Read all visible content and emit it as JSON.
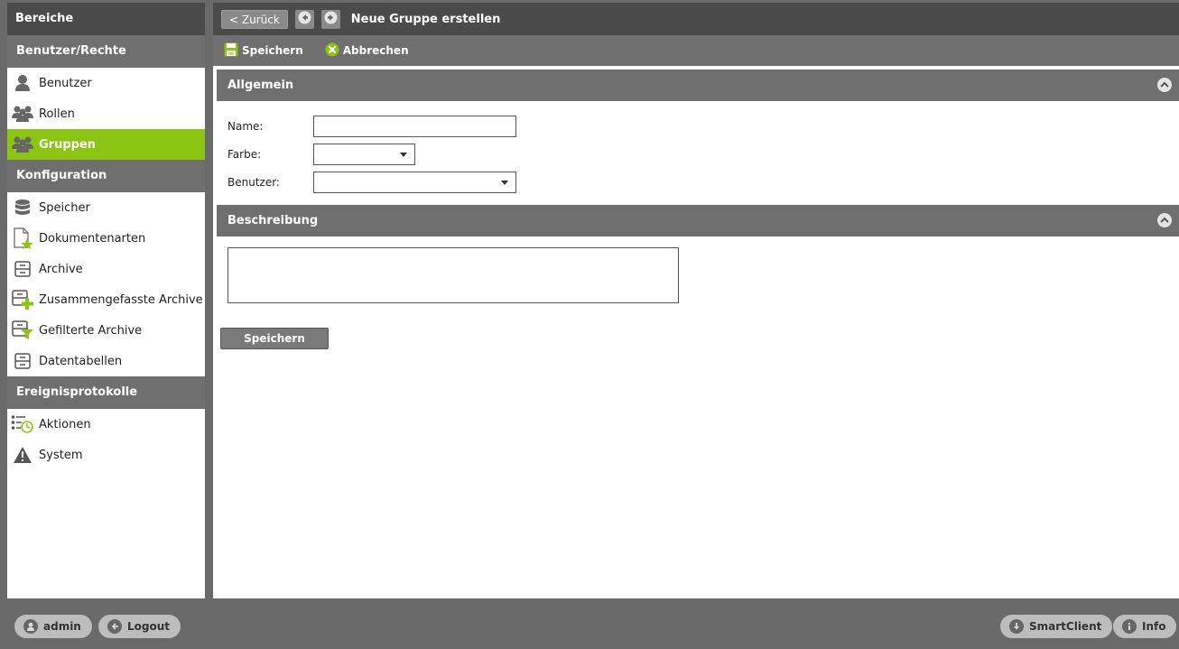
{
  "sidebar": {
    "title": "Bereiche",
    "sections": [
      {
        "label": "Benutzer/Rechte",
        "items": [
          {
            "label": "Benutzer",
            "icon": "user-icon",
            "active": false
          },
          {
            "label": "Rollen",
            "icon": "roles-icon",
            "active": false
          },
          {
            "label": "Gruppen",
            "icon": "groups-icon",
            "active": true
          }
        ]
      },
      {
        "label": "Konfiguration",
        "items": [
          {
            "label": "Speicher",
            "icon": "database-icon",
            "active": false
          },
          {
            "label": "Dokumentenarten",
            "icon": "document-star-icon",
            "active": false
          },
          {
            "label": "Archive",
            "icon": "archive-icon",
            "active": false
          },
          {
            "label": "Zusammengefasste Archive",
            "icon": "archive-plus-icon",
            "active": false
          },
          {
            "label": "Gefilterte Archive",
            "icon": "archive-filter-icon",
            "active": false
          },
          {
            "label": "Datentabellen",
            "icon": "table-icon",
            "active": false
          }
        ]
      },
      {
        "label": "Ereignisprotokolle",
        "items": [
          {
            "label": "Aktionen",
            "icon": "actions-icon",
            "active": false
          },
          {
            "label": "System",
            "icon": "warning-icon",
            "active": false
          }
        ]
      }
    ]
  },
  "topbar": {
    "back_label": "< Zurück",
    "title": "Neue Gruppe erstellen"
  },
  "toolbar": {
    "save_label": "Speichern",
    "cancel_label": "Abbrechen"
  },
  "general_panel": {
    "title": "Allgemein",
    "name_label": "Name:",
    "name_value": "",
    "color_label": "Farbe:",
    "color_value": "",
    "users_label": "Benutzer:",
    "users_value": ""
  },
  "description_panel": {
    "title": "Beschreibung",
    "value": ""
  },
  "save_button_label": "Speichern",
  "footer": {
    "user_label": "admin",
    "logout_label": "Logout",
    "smartclient_label": "SmartClient",
    "info_label": "Info"
  },
  "colors": {
    "accent": "#8bc412",
    "dark_header": "#4b4b4b",
    "section_header": "#6f6f6f"
  }
}
